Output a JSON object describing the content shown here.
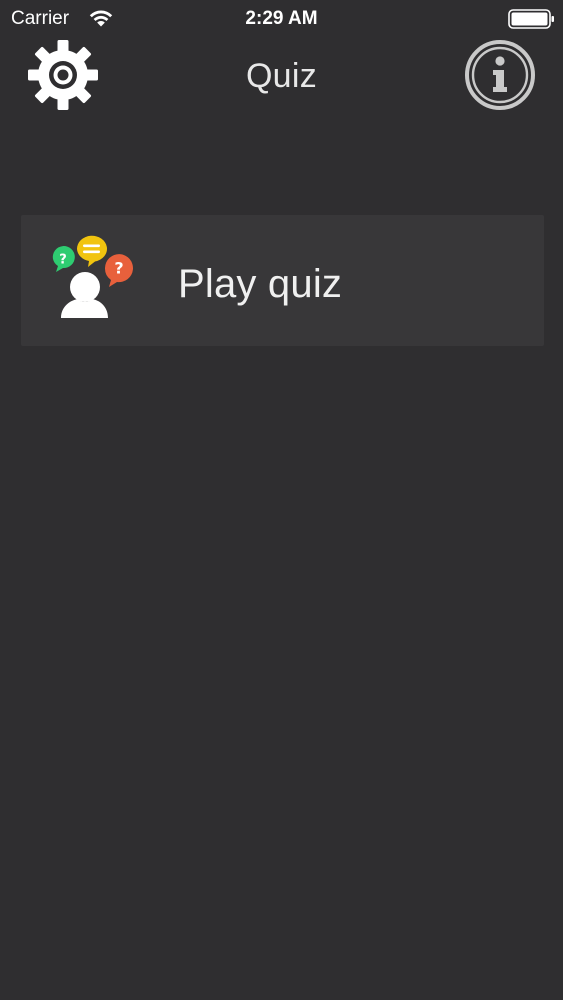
{
  "status_bar": {
    "carrier": "Carrier",
    "time": "2:29 AM",
    "wifi_icon": "wifi-icon",
    "battery_icon": "battery-icon"
  },
  "nav": {
    "title": "Quiz",
    "left_icon": "gear-icon",
    "right_icon": "info-icon"
  },
  "menu": {
    "items": [
      {
        "label": "Play quiz",
        "icon": "quiz-person-speech-bubbles-icon",
        "icon_colors": [
          "#2ecc71",
          "#f1c40f",
          "#e8603c",
          "#ffffff"
        ]
      }
    ]
  },
  "colors": {
    "background": "#2f2e30",
    "card": "#383739",
    "text": "#ffffff"
  }
}
